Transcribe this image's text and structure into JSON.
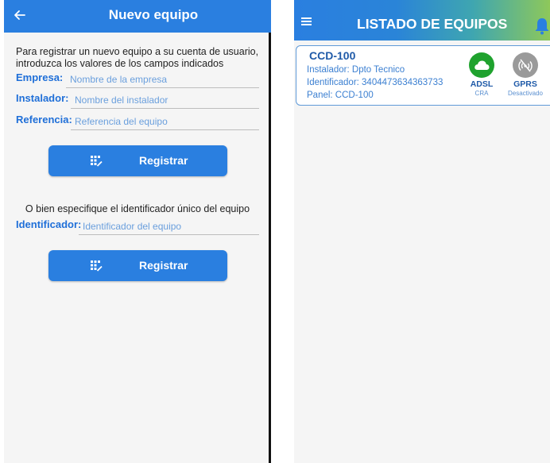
{
  "left_screen": {
    "title": "Nuevo equipo",
    "intro": "Para registrar un nuevo equipo a su cuenta de usuario, introduzca los valores de los campos indicados",
    "fields": [
      {
        "label": "Empresa:",
        "placeholder": "Nombre de la empresa",
        "value": ""
      },
      {
        "label": "Instalador:",
        "placeholder": "Nombre del instalador",
        "value": ""
      },
      {
        "label": "Referencia:",
        "placeholder": "Referencia del equipo",
        "value": ""
      }
    ],
    "register_label": "Registrar",
    "alt_text": "O bien especifique el identificador único del equipo",
    "identifier_field": {
      "label": "Identificador:",
      "placeholder": "Identificador del equipo",
      "value": ""
    },
    "register_label_2": "Registrar"
  },
  "right_screen": {
    "title": "LISTADO DE EQUIPOS",
    "card": {
      "title": "CCD-100",
      "installer": "Instalador: Dpto Tecnico",
      "identifier": "Identificador: 3404473634363733",
      "panel": "Panel: CCD-100",
      "adsl": {
        "name": "ADSL",
        "sub": "CRA",
        "color": "#1fa22e",
        "icon": "cloud-icon"
      },
      "gprs": {
        "name": "GPRS",
        "sub": "Desactivado",
        "color": "#9a9a9a",
        "icon": "signal-off-icon"
      }
    }
  },
  "colors": {
    "primary": "#2a7fe0",
    "label_blue": "#1f6fd8",
    "adsl_green": "#1fa22e",
    "bell_yellow": "#f5c518"
  },
  "icons": {
    "back": "arrow-left-icon",
    "button": "keypad-icon",
    "menu": "hamburger-menu-icon",
    "notifications": "bell-icon"
  }
}
